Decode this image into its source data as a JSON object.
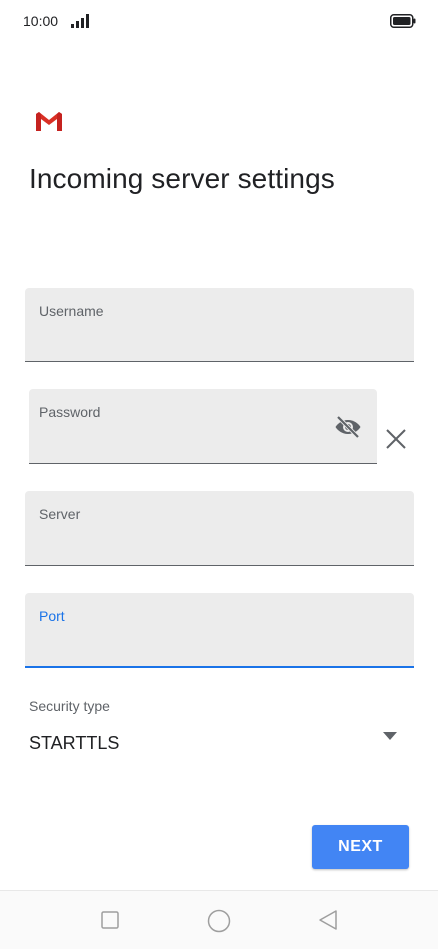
{
  "status_bar": {
    "time": "10:00",
    "signal_icon": "signal-icon",
    "battery_icon": "battery-icon"
  },
  "app": {
    "logo_icon": "gmail-logo-icon",
    "title": "Incoming server settings"
  },
  "form": {
    "username": {
      "label": "Username",
      "value": ""
    },
    "password": {
      "label": "Password",
      "value": "",
      "toggle_icon": "visibility-off-icon",
      "clear_icon": "close-icon"
    },
    "server": {
      "label": "Server",
      "value": ""
    },
    "port": {
      "label": "Port",
      "value": "",
      "focused": true
    },
    "security": {
      "label": "Security type",
      "value": "STARTTLS",
      "dropdown_icon": "dropdown-arrow-icon"
    }
  },
  "actions": {
    "next_label": "NEXT"
  },
  "nav_bar": {
    "recents_icon": "square-icon",
    "home_icon": "circle-icon",
    "back_icon": "back-triangle-icon"
  },
  "colors": {
    "accent": "#1a73e8",
    "button": "#4285f4",
    "field_bg": "#ececec",
    "gmail_red": "#d93025"
  }
}
